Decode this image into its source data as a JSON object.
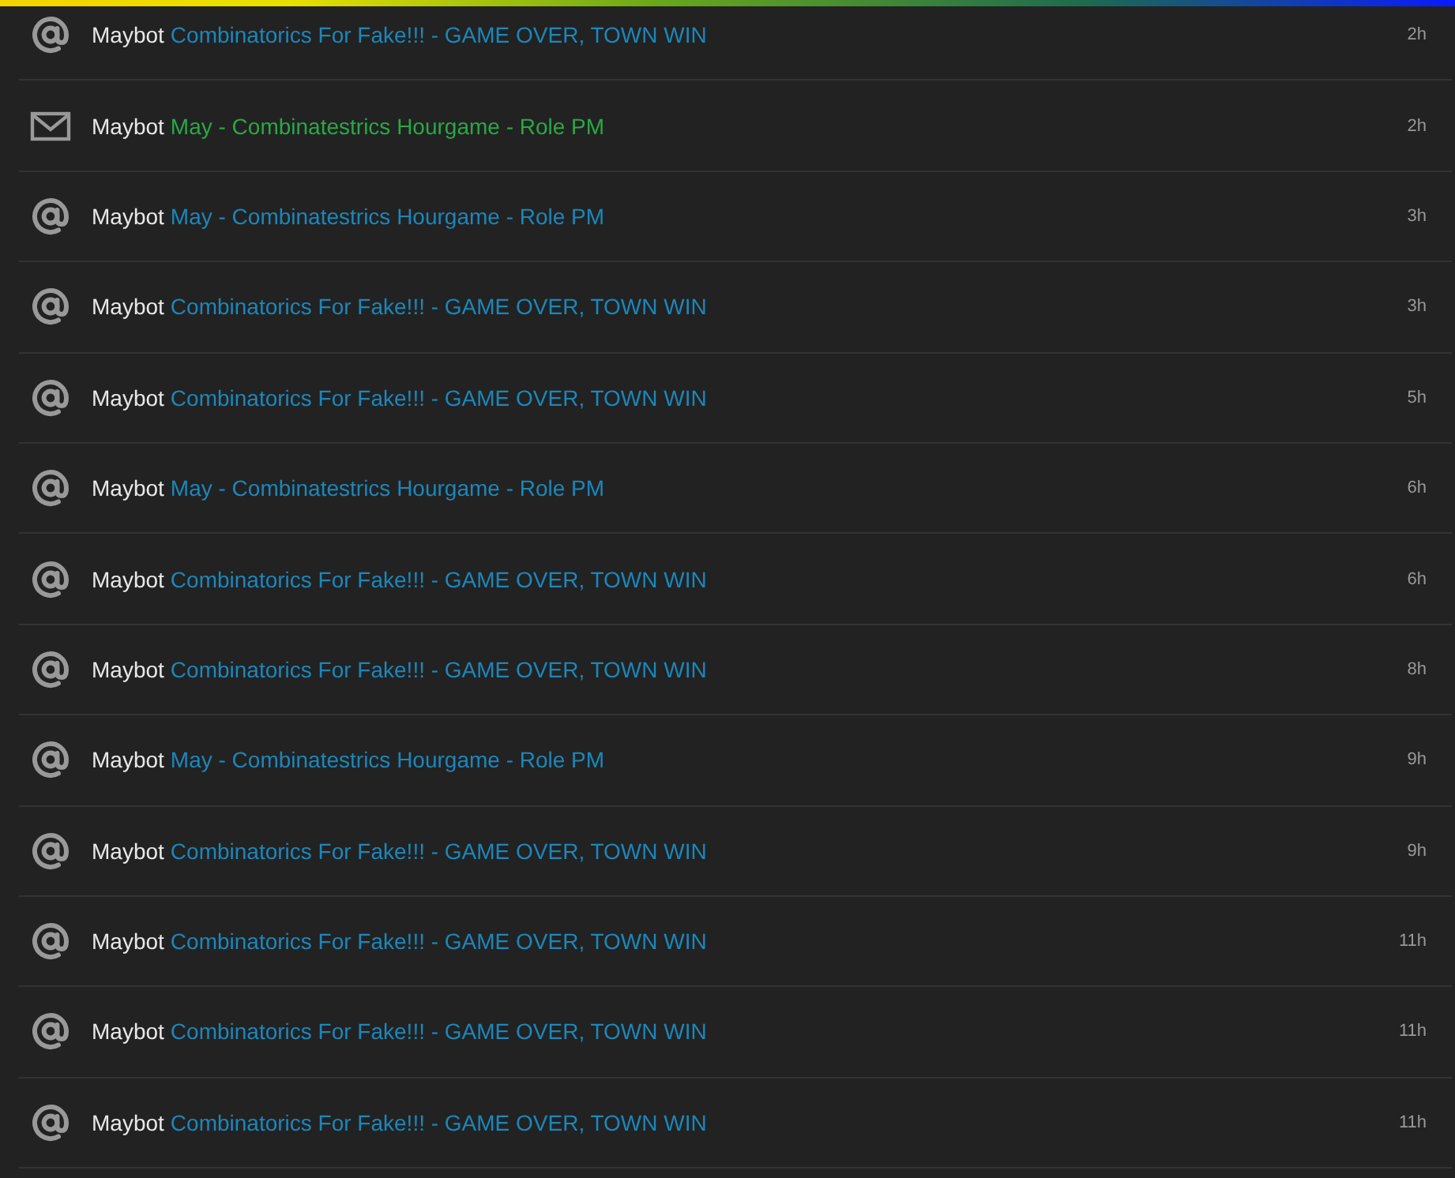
{
  "notifications": [
    {
      "kind": "mention",
      "user": "Maybot",
      "title": "Combinatorics For Fake!!! - GAME OVER, TOWN WIN",
      "time": "2h"
    },
    {
      "kind": "message",
      "user": "Maybot",
      "title": "May - Combinatestrics Hourgame - Role PM",
      "time": "2h"
    },
    {
      "kind": "mention",
      "user": "Maybot",
      "title": "May - Combinatestrics Hourgame - Role PM",
      "time": "3h"
    },
    {
      "kind": "mention",
      "user": "Maybot",
      "title": "Combinatorics For Fake!!! - GAME OVER, TOWN WIN",
      "time": "3h"
    },
    {
      "kind": "mention",
      "user": "Maybot",
      "title": "Combinatorics For Fake!!! - GAME OVER, TOWN WIN",
      "time": "5h"
    },
    {
      "kind": "mention",
      "user": "Maybot",
      "title": "May - Combinatestrics Hourgame - Role PM",
      "time": "6h"
    },
    {
      "kind": "mention",
      "user": "Maybot",
      "title": "Combinatorics For Fake!!! - GAME OVER, TOWN WIN",
      "time": "6h"
    },
    {
      "kind": "mention",
      "user": "Maybot",
      "title": "Combinatorics For Fake!!! - GAME OVER, TOWN WIN",
      "time": "8h"
    },
    {
      "kind": "mention",
      "user": "Maybot",
      "title": "May - Combinatestrics Hourgame - Role PM",
      "time": "9h"
    },
    {
      "kind": "mention",
      "user": "Maybot",
      "title": "Combinatorics For Fake!!! - GAME OVER, TOWN WIN",
      "time": "9h"
    },
    {
      "kind": "mention",
      "user": "Maybot",
      "title": "Combinatorics For Fake!!! - GAME OVER, TOWN WIN",
      "time": "11h"
    },
    {
      "kind": "mention",
      "user": "Maybot",
      "title": "Combinatorics For Fake!!! - GAME OVER, TOWN WIN",
      "time": "11h"
    },
    {
      "kind": "mention",
      "user": "Maybot",
      "title": "Combinatorics For Fake!!! - GAME OVER, TOWN WIN",
      "time": "11h"
    }
  ]
}
